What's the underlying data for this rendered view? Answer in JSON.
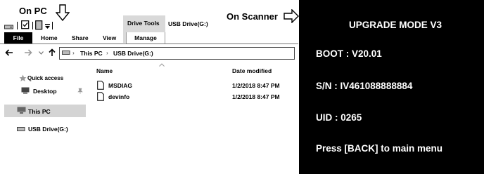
{
  "callouts": {
    "on_pc": "On PC",
    "on_scanner": "On Scanner"
  },
  "ribbon": {
    "file": "File",
    "home": "Home",
    "share": "Share",
    "view": "View",
    "drive_tools": "Drive Tools",
    "manage": "Manage",
    "window_title": "USB Drive(G:)"
  },
  "address_bar": {
    "crumbs": [
      "This PC",
      "USB Drive(G:)"
    ]
  },
  "nav": {
    "quick_access": "Quick access",
    "desktop": "Desktop",
    "this_pc": "This PC",
    "usb_drive": "USB Drive(G:)"
  },
  "file_list": {
    "columns": {
      "name": "Name",
      "date_modified": "Date modified"
    },
    "rows": [
      {
        "name": "MSDIAG",
        "date": "1/2/2018 8:47 PM"
      },
      {
        "name": "devinfo",
        "date": "1/2/2018 8:47 PM"
      }
    ]
  },
  "scanner": {
    "title": "UPGRADE MODE V3",
    "boot": "BOOT : V20.01",
    "sn": "S/N : IV461088888884",
    "uid": "UID : 0265",
    "hint": "Press [BACK] to main menu"
  }
}
